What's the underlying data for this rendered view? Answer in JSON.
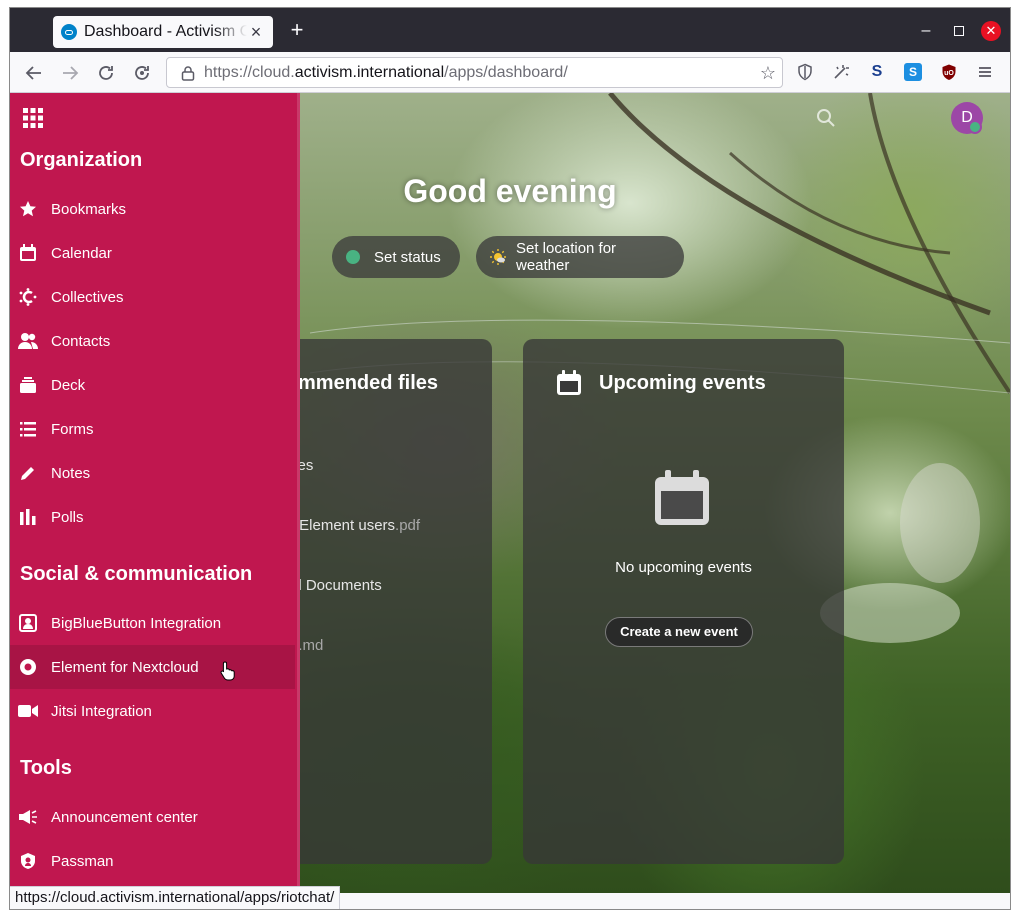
{
  "browser": {
    "tab_title": "Dashboard - Activism Cloud",
    "new_tab_label": "+",
    "url_prefix": "https://cloud.",
    "url_domain": "activism.international",
    "url_path": "/apps/dashboard/",
    "status_link": "https://cloud.activism.international/apps/riotchat/"
  },
  "dashboard": {
    "greeting": "Good evening",
    "set_status_label": "Set status",
    "set_weather_label": "Set location for weather",
    "files_panel_title": "mmended files",
    "files": [
      {
        "name": "ves",
        "ext": ""
      },
      {
        "name": "r Element users",
        "ext": ".pdf"
      },
      {
        "name": "al Documents",
        "ext": ""
      },
      {
        "name": "e",
        "ext": ".md"
      }
    ],
    "events_panel_title": "Upcoming events",
    "no_events_text": "No upcoming events",
    "create_event_label": "Create a new event",
    "avatar_initial": "D"
  },
  "app_menu": {
    "sections": [
      {
        "title": "Organization",
        "items": [
          {
            "label": "Bookmarks",
            "icon": "star-icon"
          },
          {
            "label": "Calendar",
            "icon": "calendar-icon"
          },
          {
            "label": "Collectives",
            "icon": "collectives-icon"
          },
          {
            "label": "Contacts",
            "icon": "contacts-icon"
          },
          {
            "label": "Deck",
            "icon": "deck-icon"
          },
          {
            "label": "Forms",
            "icon": "forms-icon"
          },
          {
            "label": "Notes",
            "icon": "pencil-icon"
          },
          {
            "label": "Polls",
            "icon": "polls-icon"
          }
        ]
      },
      {
        "title": "Social & communication",
        "items": [
          {
            "label": "BigBlueButton Integration",
            "icon": "bigbluebutton-icon"
          },
          {
            "label": "Element for Nextcloud",
            "icon": "element-icon"
          },
          {
            "label": "Jitsi Integration",
            "icon": "video-icon"
          }
        ]
      },
      {
        "title": "Tools",
        "items": [
          {
            "label": "Announcement center",
            "icon": "megaphone-icon"
          },
          {
            "label": "Passman",
            "icon": "passman-icon"
          }
        ]
      }
    ]
  },
  "colors": {
    "menu_bg": "#c0174f",
    "status_online": "#49b382",
    "avatar_bg": "#9c47a6"
  }
}
